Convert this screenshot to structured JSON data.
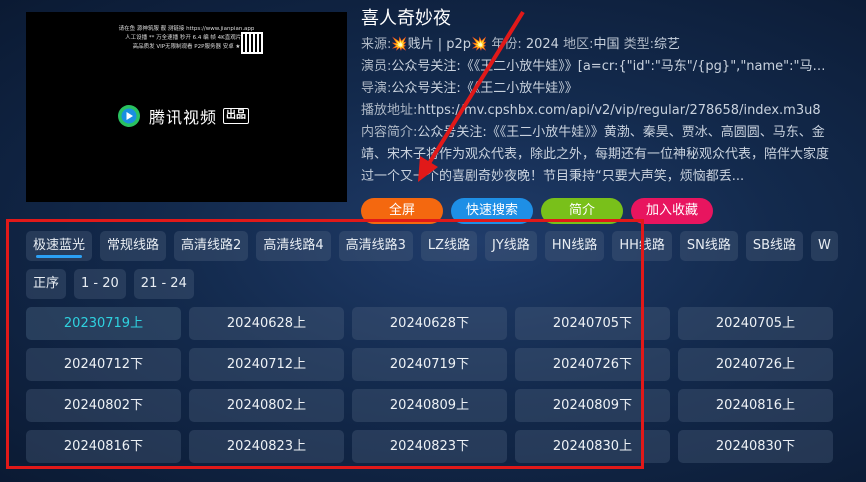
{
  "poster": {
    "ad_lines": [
      "请在鱼 源神筑服 靓 测链接 https://www.jianpian.app",
      "人工设播 ** 万全速播 秒开  6.4 编 帧 4K直观片 ★",
      "高品质发  VIP无限制观看  P2P服务器 安卓 ★"
    ],
    "logo_text": "腾讯视频",
    "logo_badge": "出品"
  },
  "details": {
    "title": "喜人奇妙夜",
    "source_label": "来源:",
    "source_value": "💥贱片 | p2p💥",
    "year_label": "年份:",
    "year_value": "2024",
    "region_label": "地区:",
    "region_value": "中国",
    "type_label": "类型:",
    "type_value": "综艺",
    "actor_label": "演员:",
    "actor_value": "公众号关注:《《王二小放牛娃》》[a=cr:{\"id\":\"马东\"/{pg}\",\"name\":\"马东\"...",
    "director_label": "导演:",
    "director_value": "公众号关注:《《王二小放牛娃》》",
    "play_label": "播放地址:",
    "play_value": "https://mv.cpshbx.com/api/v2/vip/regular/278658/index.m3u8",
    "intro_label": "内容简介:",
    "intro_value": "公众号关注:《《王二小放牛娃》》黄渤、秦昊、贾冰、高圆圆、马东、金靖、宋木子将作为观众代表，除此之外，每期还有一位神秘观众代表，陪伴大家度过一个又一个的喜剧奇妙夜晚！节目秉持“只要大声笑，烦恼都丢..."
  },
  "buttons": {
    "fullscreen": "全屏",
    "quick_search": "快速搜索",
    "intro": "简介",
    "favorite": "加入收藏"
  },
  "lines": [
    "极速蓝光",
    "常规线路",
    "高清线路2",
    "高清线路4",
    "高清线路3",
    "LZ线路",
    "JY线路",
    "HN线路",
    "HH线路",
    "SN线路",
    "SB线路",
    "W"
  ],
  "sorts": [
    "正序",
    "1 - 20",
    "21 - 24"
  ],
  "episodes": [
    "20230719上",
    "20240628上",
    "20240628下",
    "20240705下",
    "20240705上",
    "20240712下",
    "20240712上",
    "20240719下",
    "20240726下",
    "20240726上",
    "20240802下",
    "20240802上",
    "20240809上",
    "20240809下",
    "20240816上",
    "20240816下",
    "20240823上",
    "20240823下",
    "20240830上",
    "20240830下"
  ],
  "colors": {
    "accent": "#2ba0f5",
    "current_episode": "#2fd2e0",
    "annotation_red": "#e11919",
    "fullscreen_btn": "#f4680f",
    "search_btn": "#1e8fe6",
    "intro_btn": "#79c01a",
    "favorite_btn": "#e8155f"
  }
}
